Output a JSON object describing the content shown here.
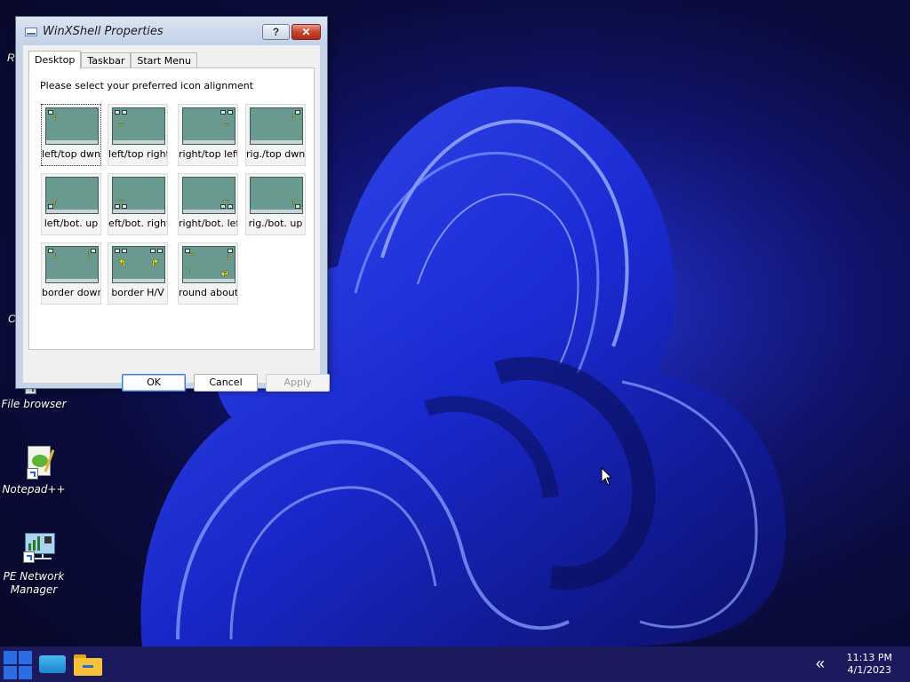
{
  "window": {
    "title": "WinXShell Properties",
    "help_label": "?",
    "close_label": "✕",
    "tabs": [
      "Desktop",
      "Taskbar",
      "Start Menu"
    ],
    "active_tab": "Desktop",
    "prompt": "Please select your preferred icon alignment",
    "options": [
      {
        "label": "left/top dwn",
        "selected": true
      },
      {
        "label": "left/top right"
      },
      {
        "label": "right/top left"
      },
      {
        "label": "rig./top dwn"
      },
      {
        "label": "left/bot. up"
      },
      {
        "label": "eft/bot. right"
      },
      {
        "label": "right/bot. left"
      },
      {
        "label": "rig./bot. up"
      },
      {
        "label": "border down"
      },
      {
        "label": "border H/V"
      },
      {
        "label": "round about"
      }
    ],
    "buttons": {
      "ok": "OK",
      "cancel": "Cancel",
      "apply": "Apply"
    }
  },
  "desktop": {
    "icons": [
      {
        "label": "File browser",
        "icon": "folder-icon"
      },
      {
        "label": "Notepad++",
        "icon": "notepadpp-icon"
      },
      {
        "label": "PE Network Manager",
        "icon": "network-icon"
      }
    ],
    "partial_labels": [
      "R",
      "C"
    ]
  },
  "taskbar": {
    "time": "11:13 PM",
    "date": "4/1/2023",
    "overflow_label": "«",
    "items": [
      "start-icon",
      "monitor-icon",
      "file-explorer-icon"
    ]
  },
  "colors": {
    "taskbar": "#1a1a5c",
    "accent": "#2b6de4",
    "thumb": "#6a9a8f",
    "arrow": "#f6e21a"
  }
}
